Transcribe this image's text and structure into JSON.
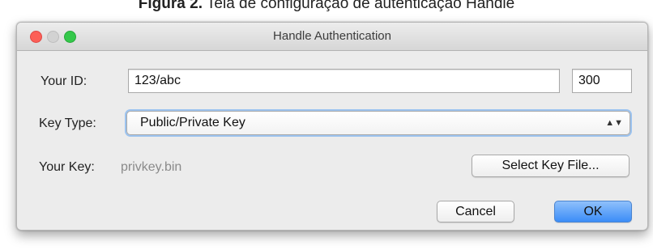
{
  "caption": {
    "prefix": "Figura 2.",
    "text": "Tela de configuração de autenticação Handle"
  },
  "window": {
    "title": "Handle Authentication"
  },
  "form": {
    "your_id_label": "Your ID:",
    "your_id_value": "123/abc",
    "index_value": "300",
    "key_type_label": "Key Type:",
    "key_type_selected": "Public/Private Key",
    "your_key_label": "Your Key:",
    "your_key_value": "privkey.bin",
    "select_key_file_label": "Select Key File..."
  },
  "buttons": {
    "cancel_label": "Cancel",
    "ok_label": "OK"
  },
  "colors": {
    "close": "#fc5f57",
    "minimize": "#d2d2d2",
    "zoom": "#34c84a",
    "primary": "#3b8df7"
  }
}
